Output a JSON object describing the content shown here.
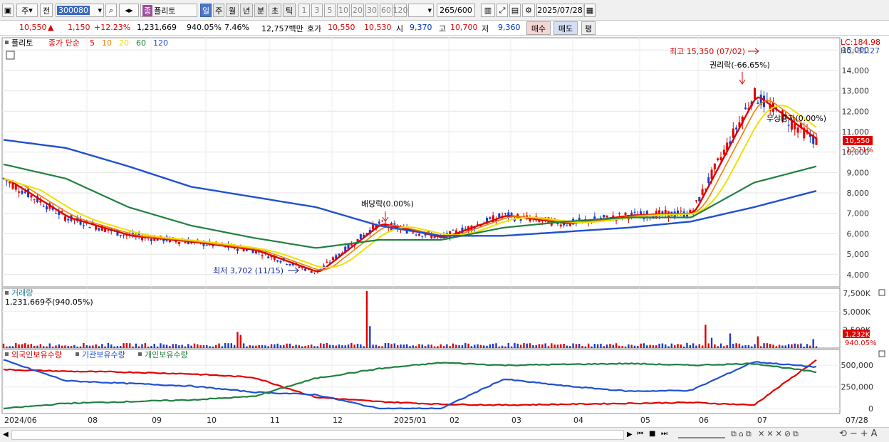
{
  "toolbar": {
    "period_main": "주",
    "prev_label": "전",
    "stock_code": "300080",
    "stock_badge": "종",
    "stock_name": "플리토",
    "period_tabs": [
      "일",
      "주",
      "월",
      "년",
      "분",
      "초",
      "틱"
    ],
    "active_tab": "일",
    "minute_options": [
      "1",
      "3",
      "5",
      "10",
      "20",
      "30",
      "60",
      "120"
    ],
    "count": "265",
    "count_max": "/600",
    "date": "2025/07/28"
  },
  "quote": {
    "price": "10,550",
    "change_arrow": "▲",
    "change": "1,150",
    "change_pct": "+12.23%",
    "volume": "1,231,669",
    "volume_ratio": "940.05%",
    "turnover": "7.46%",
    "amount": "12,757백만",
    "bid_label": "호가",
    "ask_price": "10,550",
    "bid_price": "10,530",
    "open_label": "시",
    "open": "9,370",
    "high_label": "고",
    "high": "10,700",
    "low_label": "저",
    "low": "9,360",
    "buy_label": "매수",
    "sell_label": "매도",
    "eval_label": "평"
  },
  "price_panel": {
    "name": "플리토",
    "indicator_label": "종가 단순",
    "ma_periods": [
      "5",
      "10",
      "20",
      "60",
      "120"
    ],
    "ma_colors": [
      "#e00000",
      "#f08000",
      "#f0e000",
      "#208040",
      "#2050d0"
    ],
    "lc": "LC:184.98",
    "hc": "HC:-31.27",
    "current_price": "10,550",
    "current_pct": "12.71%",
    "high_annotation": "최고 15,350 (07/02)",
    "low_annotation": "최저 3,702 (11/15)",
    "rights_annotation": "권리락(-66.65%)",
    "dividend_annotation": "배당락(0.00%)",
    "bonus_annotation": "무상증자(0.00%)",
    "y_ticks": [
      "15,000",
      "14,000",
      "13,000",
      "12,000",
      "11,000",
      "10,000",
      "9,000",
      "8,000",
      "7,000",
      "6,000",
      "5,000",
      "4,000"
    ]
  },
  "volume_panel": {
    "title": "거래량",
    "value": "1,231,669주(940.05%)",
    "y_ticks": [
      "7,500K",
      "5,000K",
      "2,500K"
    ],
    "current": "1,232K",
    "current_pct": "940.05%"
  },
  "holding_panel": {
    "series": [
      "외국인보유수량",
      "기관보유수량",
      "개인보유수량"
    ],
    "colors": [
      "#e00000",
      "#2050d0",
      "#208040"
    ],
    "y_ticks": [
      "500,000",
      "250,000",
      "0"
    ]
  },
  "x_axis": [
    "2024/06",
    "08",
    "09",
    "10",
    "11",
    "12",
    "2025/01",
    "02",
    "03",
    "04",
    "05",
    "06",
    "07",
    "07/28"
  ],
  "chart_data": {
    "type": "line",
    "title": "플리토",
    "x": [
      "2024/06",
      "08",
      "09",
      "10",
      "11",
      "12",
      "2025/01",
      "02",
      "03",
      "04",
      "05",
      "06",
      "07",
      "07/28"
    ],
    "series": [
      {
        "name": "5",
        "values": [
          8700,
          6800,
          5900,
          5600,
          5200,
          4100,
          6500,
          5800,
          6900,
          6500,
          6900,
          7000,
          12800,
          10550
        ]
      },
      {
        "name": "60",
        "values": [
          9400,
          8700,
          7300,
          6400,
          5800,
          5300,
          5700,
          5700,
          6300,
          6600,
          6800,
          6800,
          8500,
          9300
        ]
      },
      {
        "name": "120",
        "values": [
          10600,
          10200,
          9300,
          8300,
          7800,
          7300,
          6400,
          5900,
          5900,
          6100,
          6300,
          6600,
          7300,
          8100
        ]
      }
    ],
    "ylim": [
      3400,
      15600
    ]
  }
}
